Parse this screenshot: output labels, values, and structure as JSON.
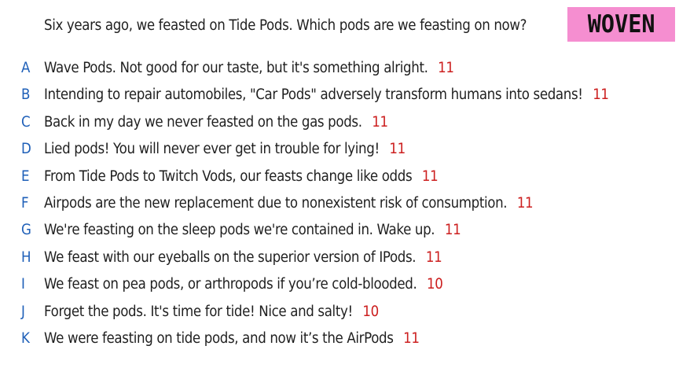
{
  "question": "Six years ago, we feasted on Tide Pods. Which pods are we feasting on now?",
  "logo": "WOVEN",
  "colors": {
    "logo_background": "#f58ed0",
    "letter": "#1e5fb8",
    "score": "#cc1f1f",
    "text": "#1f1f1f"
  },
  "answers": [
    {
      "letter": "A",
      "text": "Wave Pods. Not good for our taste, but it's something alright.",
      "score": "11"
    },
    {
      "letter": "B",
      "text": "Intending to repair automobiles, \"Car Pods\" adversely transform humans into sedans!",
      "score": "11"
    },
    {
      "letter": "C",
      "text": "Back in my day we never feasted on the gas pods.",
      "score": "11"
    },
    {
      "letter": "D",
      "text": "Lied pods! You will never ever get in trouble for lying!",
      "score": "11"
    },
    {
      "letter": "E",
      "text": "From Tide Pods to Twitch Vods, our feasts change like odds",
      "score": "11"
    },
    {
      "letter": "F",
      "text": "Airpods are the new replacement due to nonexistent risk of consumption.",
      "score": "11"
    },
    {
      "letter": "G",
      "text": "We're feasting on the sleep pods we're contained in. Wake up.",
      "score": "11"
    },
    {
      "letter": "H",
      "text": "We feast with our eyeballs on the superior version of IPods.",
      "score": "11"
    },
    {
      "letter": "I",
      "text": "We feast on pea pods, or arthropods if you’re cold-blooded.",
      "score": "10"
    },
    {
      "letter": "J",
      "text": "Forget the pods. It's time for tide! Nice and salty!",
      "score": "10"
    },
    {
      "letter": "K",
      "text": "We were feasting on tide pods, and now it’s the AirPods",
      "score": "11"
    }
  ]
}
